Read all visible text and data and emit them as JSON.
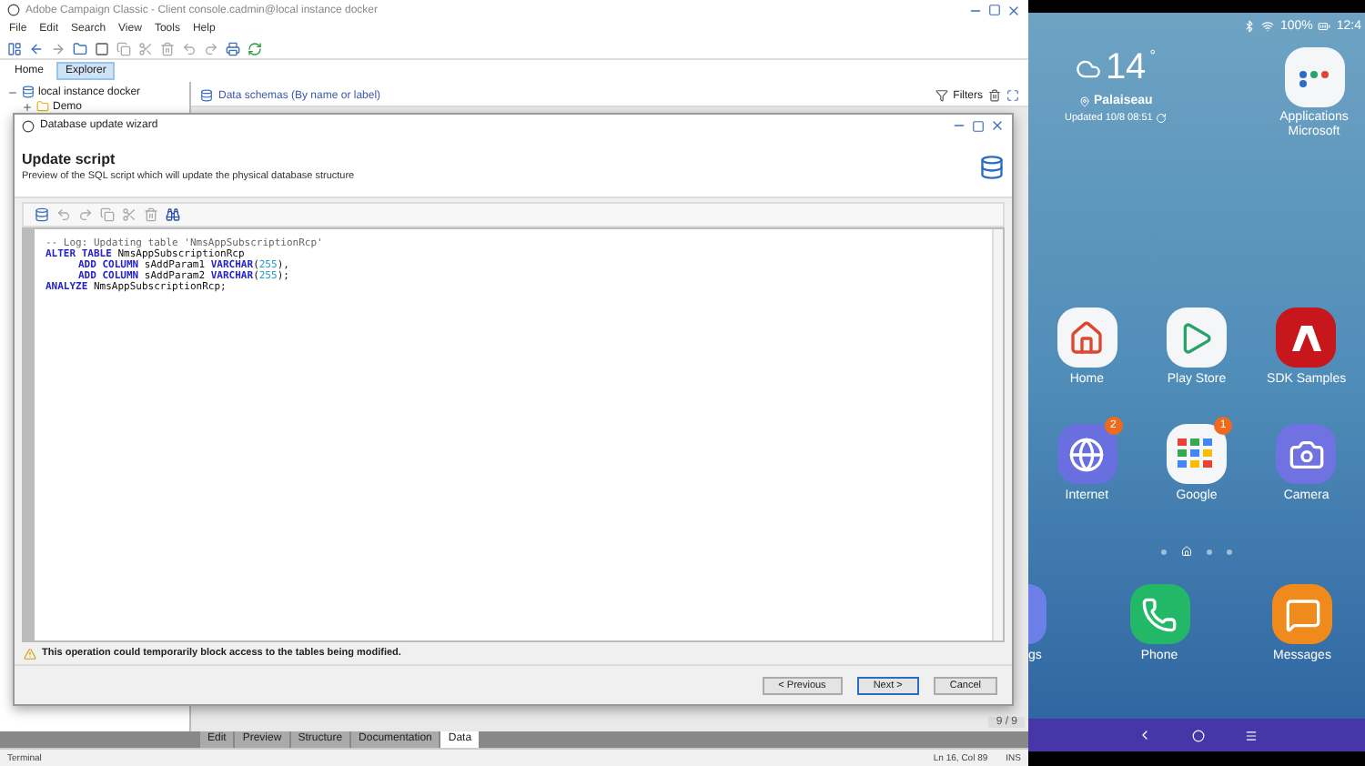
{
  "app": {
    "title": "Adobe Campaign Classic - Client console.cadmin@local instance docker",
    "menu": [
      "File",
      "Edit",
      "Search",
      "View",
      "Tools",
      "Help"
    ],
    "tabs": [
      {
        "label": "Home",
        "selected": false
      },
      {
        "label": "Explorer",
        "selected": true
      }
    ],
    "tree": [
      {
        "label": "local instance docker",
        "expanded": true,
        "children": [
          {
            "label": "Demo",
            "expanded": false
          }
        ]
      }
    ],
    "panel": {
      "title": "Data schemas (By name or label)",
      "filters": "Filters"
    },
    "pager": "9 / 9",
    "bottom_tabs": [
      {
        "label": "Edit",
        "selected": false
      },
      {
        "label": "Preview",
        "selected": false
      },
      {
        "label": "Structure",
        "selected": false
      },
      {
        "label": "Documentation",
        "selected": false
      },
      {
        "label": "Data",
        "selected": true
      }
    ],
    "status_bar": {
      "left": "Terminal",
      "position": "Ln 16, Col 89",
      "mode": "INS"
    }
  },
  "dialog": {
    "title": "Database update wizard",
    "heading": "Update script",
    "subtitle": "Preview of the SQL script which will update the physical database structure",
    "code": [
      {
        "indented": false,
        "tokens": [
          {
            "kind": "comment",
            "text": "-- Log: Updating table 'NmsAppSubscriptionRcp'"
          }
        ]
      },
      {
        "indented": false,
        "tokens": [
          {
            "kind": "keyword",
            "text": "ALTER TABLE"
          },
          {
            "kind": "plain",
            "text": " NmsAppSubscriptionRcp"
          }
        ]
      },
      {
        "indented": true,
        "tokens": [
          {
            "kind": "keyword",
            "text": "ADD COLUMN"
          },
          {
            "kind": "plain",
            "text": " sAddParam1 "
          },
          {
            "kind": "keyword",
            "text": "VARCHAR"
          },
          {
            "kind": "plain",
            "text": "("
          },
          {
            "kind": "number",
            "text": "255"
          },
          {
            "kind": "plain",
            "text": "),"
          }
        ]
      },
      {
        "indented": true,
        "tokens": [
          {
            "kind": "keyword",
            "text": "ADD COLUMN"
          },
          {
            "kind": "plain",
            "text": " sAddParam2 "
          },
          {
            "kind": "keyword",
            "text": "VARCHAR"
          },
          {
            "kind": "plain",
            "text": "("
          },
          {
            "kind": "number",
            "text": "255"
          },
          {
            "kind": "plain",
            "text": ");"
          }
        ]
      },
      {
        "indented": false,
        "tokens": [
          {
            "kind": "keyword",
            "text": "ANALYZE"
          },
          {
            "kind": "plain",
            "text": " NmsAppSubscriptionRcp;"
          }
        ]
      }
    ],
    "warning": "This operation could temporarily block access to the tables being modified.",
    "buttons": [
      {
        "label": "< Previous",
        "selected": false
      },
      {
        "label": "Next >",
        "selected": true
      },
      {
        "label": "Cancel",
        "selected": false
      }
    ]
  },
  "phone": {
    "battery": "100%",
    "time": "12:4",
    "weather": {
      "temperature": "14",
      "degree": "°",
      "city": "Palaiseau",
      "updated": "Updated 10/8 08:51"
    },
    "folder": {
      "label": "Applications Microsoft"
    },
    "apps": [
      {
        "label": "Home",
        "kind": "home"
      },
      {
        "label": "Play Store",
        "kind": "play"
      },
      {
        "label": "SDK Samples",
        "kind": "sdk"
      },
      {
        "label": "Internet",
        "kind": "internet",
        "badge": "2"
      },
      {
        "label": "Google",
        "kind": "google",
        "badge": "1"
      },
      {
        "label": "Camera",
        "kind": "camera"
      }
    ],
    "pages": [
      {
        "selected": false
      },
      {
        "selected": true
      },
      {
        "selected": false
      },
      {
        "selected": false
      }
    ],
    "dock": [
      {
        "label": "gs",
        "kind": "partial"
      },
      {
        "label": "Phone",
        "kind": "phone"
      },
      {
        "label": "Messages",
        "kind": "messages"
      }
    ]
  }
}
